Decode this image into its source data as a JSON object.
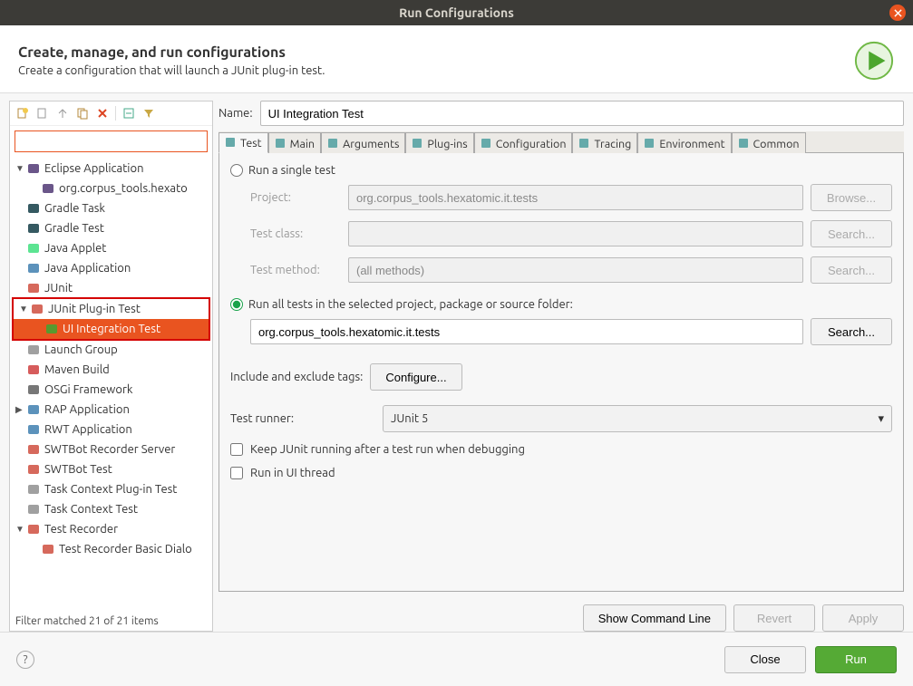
{
  "titlebar": {
    "title": "Run Configurations"
  },
  "header": {
    "title": "Create, manage, and run configurations",
    "subtitle": "Create a configuration that will launch a JUnit plug-in test."
  },
  "filter_placeholder": "",
  "tree": {
    "items": [
      {
        "label": "Eclipse Application",
        "icon": "eclipse",
        "expanded": true,
        "children": [
          {
            "label": "org.corpus_tools.hexato",
            "icon": "eclipse"
          }
        ]
      },
      {
        "label": "Gradle Task",
        "icon": "gradle"
      },
      {
        "label": "Gradle Test",
        "icon": "gradle"
      },
      {
        "label": "Java Applet",
        "icon": "applet"
      },
      {
        "label": "Java Application",
        "icon": "java"
      },
      {
        "label": "JUnit",
        "icon": "junit"
      },
      {
        "label": "JUnit Plug-in Test",
        "icon": "junit-plugin",
        "expanded": true,
        "highlighted": true,
        "children": [
          {
            "label": "UI Integration Test",
            "icon": "junit-run",
            "selected": true
          }
        ]
      },
      {
        "label": "Launch Group",
        "icon": "launch-group"
      },
      {
        "label": "Maven Build",
        "icon": "maven"
      },
      {
        "label": "OSGi Framework",
        "icon": "osgi"
      },
      {
        "label": "RAP Application",
        "icon": "rap",
        "hasChildren": true
      },
      {
        "label": "RWT Application",
        "icon": "rwt"
      },
      {
        "label": "SWTBot Recorder Server",
        "icon": "swtbot"
      },
      {
        "label": "SWTBot Test",
        "icon": "swtbot"
      },
      {
        "label": "Task Context Plug-in Test",
        "icon": "task"
      },
      {
        "label": "Task Context Test",
        "icon": "task"
      },
      {
        "label": "Test Recorder",
        "icon": "recorder",
        "expanded": true,
        "children": [
          {
            "label": "Test Recorder Basic Dialo",
            "icon": "recorder"
          }
        ]
      }
    ]
  },
  "filter_status": "Filter matched 21 of 21 items",
  "name_label": "Name:",
  "name_value": "UI Integration Test",
  "tabs": [
    {
      "label": "Test",
      "icon": "test"
    },
    {
      "label": "Main",
      "icon": "main"
    },
    {
      "label": "Arguments",
      "icon": "args"
    },
    {
      "label": "Plug-ins",
      "icon": "plugins"
    },
    {
      "label": "Configuration",
      "icon": "config"
    },
    {
      "label": "Tracing",
      "icon": "tracing"
    },
    {
      "label": "Environment",
      "icon": "env"
    },
    {
      "label": "Common",
      "icon": "common"
    }
  ],
  "test_tab": {
    "radio_single": "Run a single test",
    "project_label": "Project:",
    "project_value": "org.corpus_tools.hexatomic.it.tests",
    "browse_btn": "Browse...",
    "test_class_label": "Test class:",
    "search_btn": "Search...",
    "test_method_label": "Test method:",
    "test_method_value": "(all methods)",
    "radio_all": "Run all tests in the selected project, package or source folder:",
    "all_value": "org.corpus_tools.hexatomic.it.tests",
    "include_exclude_label": "Include and exclude tags:",
    "configure_btn": "Configure...",
    "runner_label": "Test runner:",
    "runner_value": "JUnit 5",
    "keep_running": "Keep JUnit running after a test run when debugging",
    "ui_thread": "Run in UI thread"
  },
  "actions": {
    "show_cmd": "Show Command Line",
    "revert": "Revert",
    "apply": "Apply"
  },
  "footer": {
    "close": "Close",
    "run": "Run"
  }
}
